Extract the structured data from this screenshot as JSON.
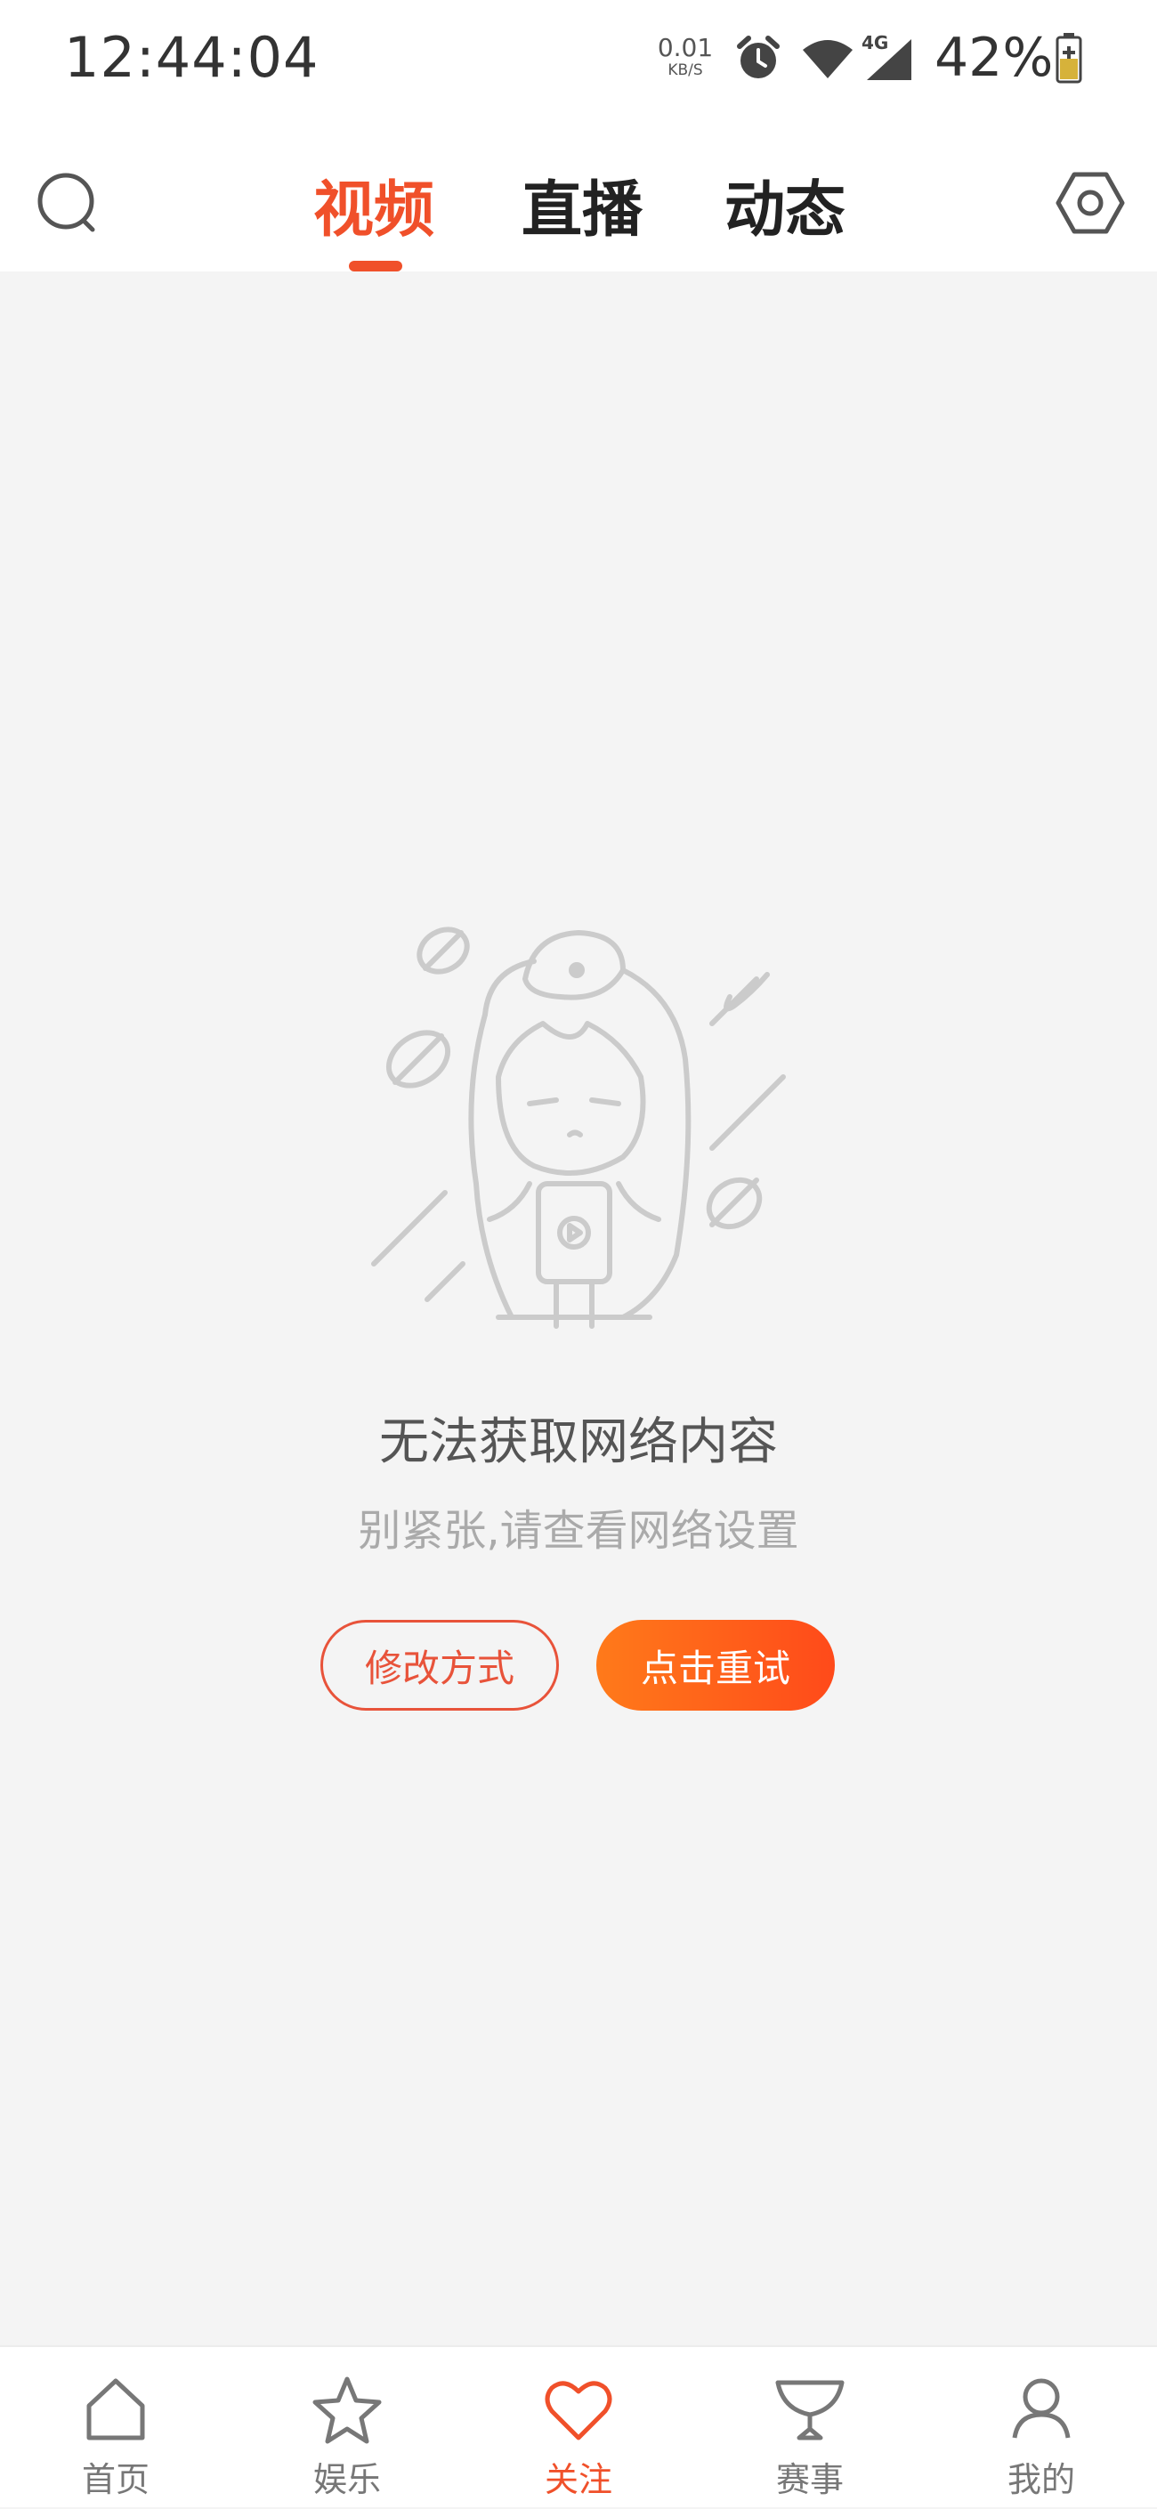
{
  "status_bar": {
    "time": "12:44:04",
    "net_speed_value": "0.01",
    "net_speed_unit": "KB/S",
    "network_type": "4G",
    "battery": "42%"
  },
  "top_nav": {
    "tabs": [
      {
        "label": "视频",
        "active": true
      },
      {
        "label": "直播",
        "active": false
      },
      {
        "label": "动态",
        "active": false
      }
    ],
    "left_icon": "search-icon",
    "right_icon": "settings-icon",
    "accent_color": "#f0502a"
  },
  "error_state": {
    "title": "无法获取网络内容",
    "subtitle": "别紧张,请查看网络设置",
    "buttons": {
      "modify": "修改方式",
      "retry": "点击重试"
    }
  },
  "bottom_nav": {
    "items": [
      {
        "label": "首页",
        "icon": "home-icon",
        "active": false
      },
      {
        "label": "娱乐",
        "icon": "star-icon",
        "active": false
      },
      {
        "label": "关注",
        "icon": "heart-icon",
        "active": true
      },
      {
        "label": "赛事",
        "icon": "trophy-icon",
        "active": false
      },
      {
        "label": "我的",
        "icon": "profile-icon",
        "active": false
      }
    ]
  }
}
